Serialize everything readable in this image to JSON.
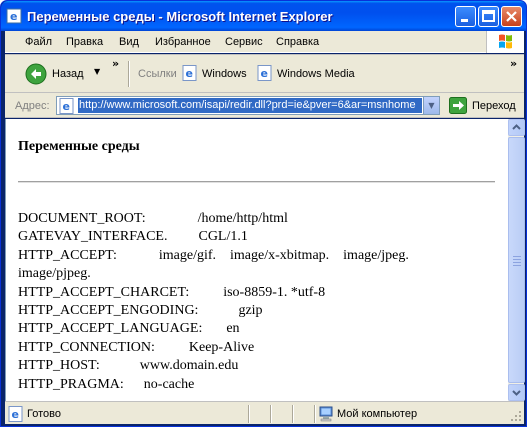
{
  "window": {
    "title": "Переменные среды - Microsoft Internet Explorer"
  },
  "menu": {
    "items": [
      "Файл",
      "Правка",
      "Вид",
      "Избранное",
      "Сервис",
      "Справка"
    ]
  },
  "toolbar": {
    "back_label": "Назад",
    "links_label": "Ссылки",
    "links": [
      "Windows",
      "Windows Media"
    ]
  },
  "address": {
    "label": "Адрес:",
    "url": "http://www.microsoft.com/isapi/redir.dll?prd=ie&pver=6&ar=msnhome",
    "go_label": "Переход"
  },
  "page": {
    "heading": "Переменные среды",
    "env": [
      {
        "name": "DOCUMENT_ROOT:",
        "value": "/home/http/html"
      },
      {
        "name": "GATEVAY_INTERFACE.",
        "value": "CGL/1.1"
      },
      {
        "name": "HTTP_ACCEPT:",
        "value": "image/gif.    image/x-xbitmap.    image/jpeg."
      },
      {
        "name": "",
        "value": "image/pjpeg."
      },
      {
        "name": "HTTP_ACCEPT_CHARCET:",
        "value": "iso-8859-1. *utf-8"
      },
      {
        "name": "HTTP_ACCEPT_ENGODING:",
        "value": "gzip"
      },
      {
        "name": "HTTP_ACCEPT_LANGUAGE:",
        "value": "en"
      },
      {
        "name": "HTTP_CONNECTION:",
        "value": "Keep-Alive"
      },
      {
        "name": "HTTP_HOST:",
        "value": "www.domain.edu"
      },
      {
        "name": "HTTP_PRAGMA:",
        "value": "no-cache"
      }
    ]
  },
  "status": {
    "text": "Готово",
    "zone": "Мой компьютер"
  },
  "colors": {
    "titlebar": "#0054e3",
    "chrome": "#ece9d8",
    "selection": "#316ac5"
  }
}
